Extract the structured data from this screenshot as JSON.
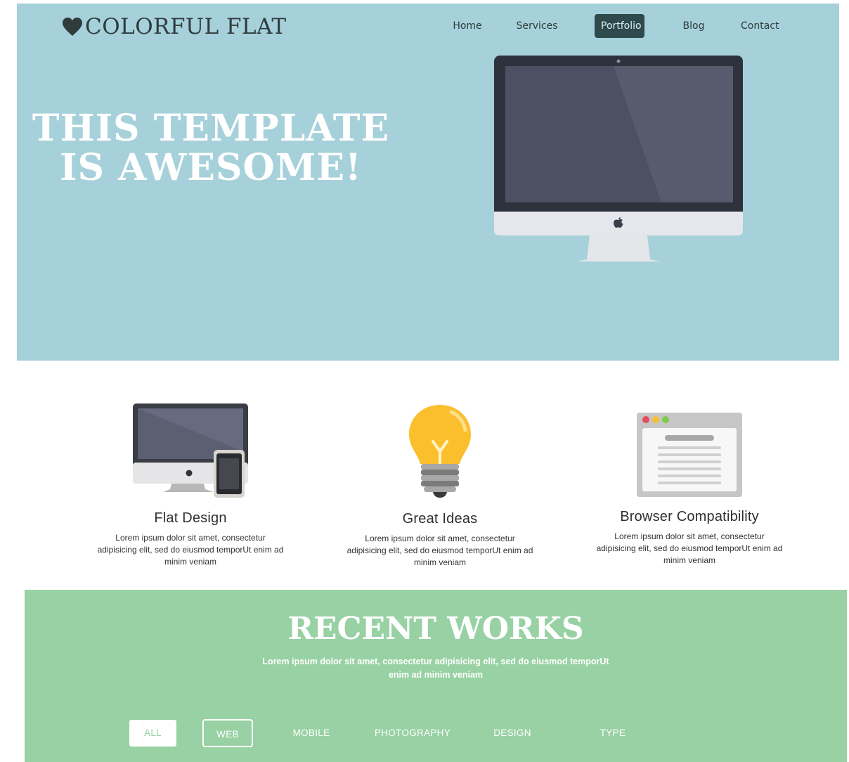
{
  "header": {
    "logo_text": "COLORFUL FLAT",
    "nav": [
      {
        "label": "Home"
      },
      {
        "label": "Services"
      },
      {
        "label": "Portfolio",
        "active": true
      },
      {
        "label": "Blog"
      },
      {
        "label": "Contact"
      }
    ]
  },
  "hero": {
    "title_line1": "THIS TEMPLATE",
    "title_line2": "IS AWESOME!"
  },
  "features": [
    {
      "icon": "desktop-tablet-icon",
      "title": "Flat Design",
      "text": "Lorem ipsum dolor sit amet, consectetur adipisicing elit, sed do eiusmod temporUt enim ad minim veniam"
    },
    {
      "icon": "lightbulb-icon",
      "title": "Great Ideas",
      "text": "Lorem ipsum dolor sit amet, consectetur adipisicing elit, sed do eiusmod temporUt enim ad minim veniam"
    },
    {
      "icon": "browser-window-icon",
      "title": "Browser Compatibility",
      "text": "Lorem ipsum dolor sit amet, consectetur adipisicing elit, sed do eiusmod temporUt enim ad minim veniam"
    }
  ],
  "works": {
    "title": "RECENT WORKS",
    "subtitle": "Lorem ipsum dolor sit amet, consectetur adipisicing elit, sed do eiusmod temporUt enim ad minim veniam",
    "filters": [
      {
        "label": "ALL",
        "selected": true
      },
      {
        "label": "WEB",
        "outlined": true
      },
      {
        "label": "MOBILE"
      },
      {
        "label": "PHOTOGRAPHY"
      },
      {
        "label": "DESIGN"
      },
      {
        "label": "TYPE"
      }
    ]
  },
  "colors": {
    "hero_bg": "#a6d1da",
    "works_bg": "#98d1a3",
    "nav_active_bg": "#2f4a4c",
    "text_dark": "#2f3b3c"
  }
}
